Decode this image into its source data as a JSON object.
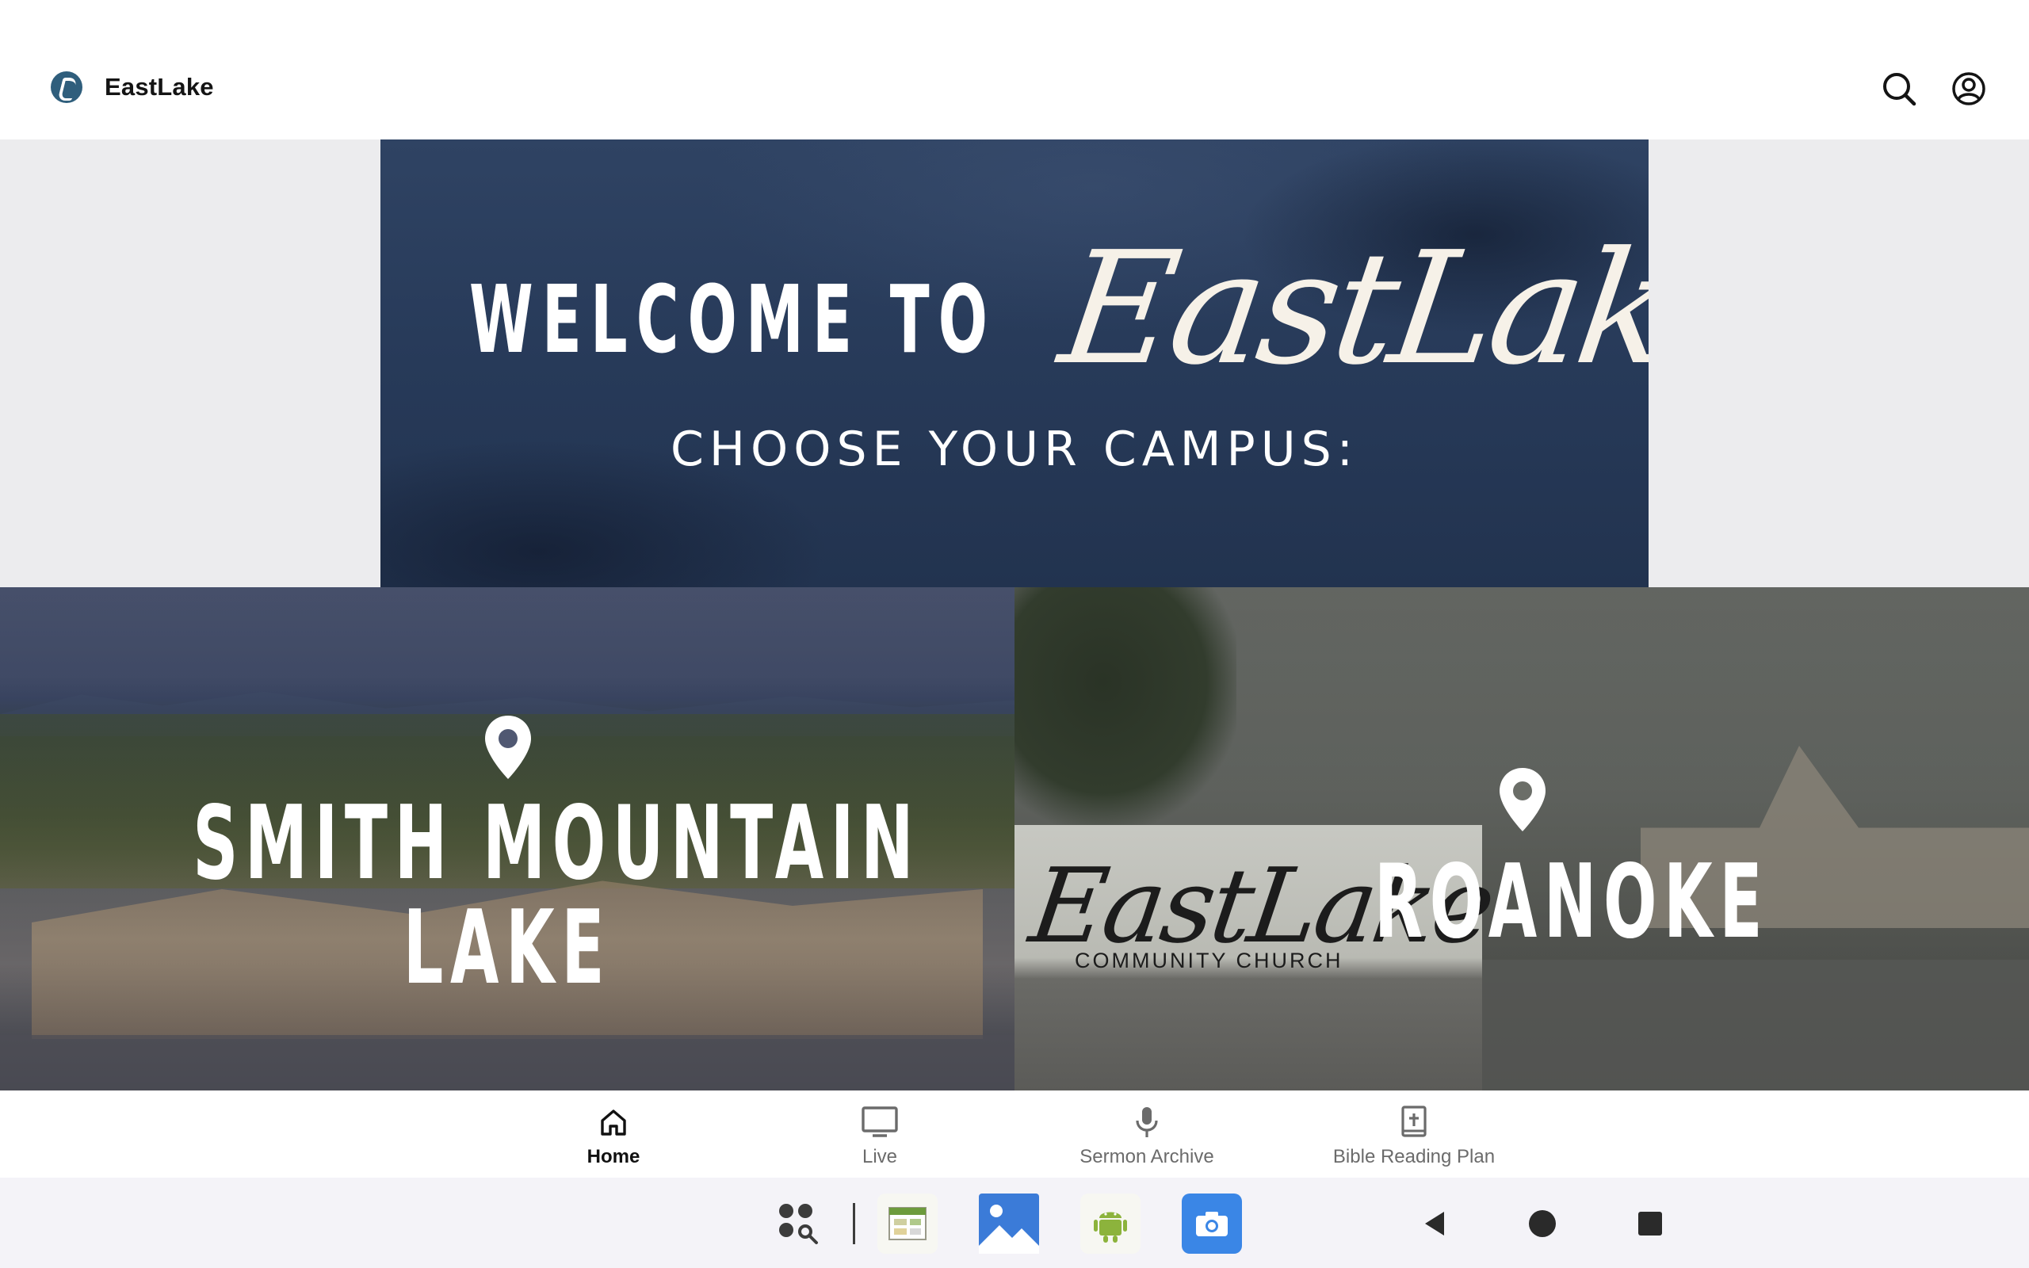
{
  "app": {
    "name": "EastLake",
    "logo_icon": "eastlake-logo-icon"
  },
  "topbar": {
    "search_icon": "search-icon",
    "account_icon": "account-circle-icon"
  },
  "hero": {
    "welcome": "WELCOME TO",
    "script_title": "EastLake",
    "subtitle": "CHOOSE YOUR CAMPUS:",
    "background_color": "#273a59"
  },
  "campuses": [
    {
      "name": "SMITH MOUNTAIN LAKE",
      "line1": "SMITH MOUNTAIN",
      "line2": "LAKE",
      "icon": "location-pin-icon"
    },
    {
      "name": "ROANOKE",
      "icon": "location-pin-icon",
      "sign_title": "EastLake",
      "sign_subtitle": "COMMUNITY CHURCH"
    }
  ],
  "bottom_nav": [
    {
      "label": "Home",
      "icon": "home-icon",
      "active": true
    },
    {
      "label": "Live",
      "icon": "tv-icon",
      "active": false
    },
    {
      "label": "Sermon Archive",
      "icon": "microphone-icon",
      "active": false
    },
    {
      "label": "Bible Reading Plan",
      "icon": "bible-icon",
      "active": false
    }
  ],
  "system_bar": {
    "dock": [
      "app-drawer-search-icon",
      "spreadsheet-app-icon",
      "gallery-app-icon",
      "android-app-icon",
      "camera-app-icon"
    ],
    "nav": [
      "back-icon",
      "home-circle-icon",
      "recents-icon"
    ]
  }
}
